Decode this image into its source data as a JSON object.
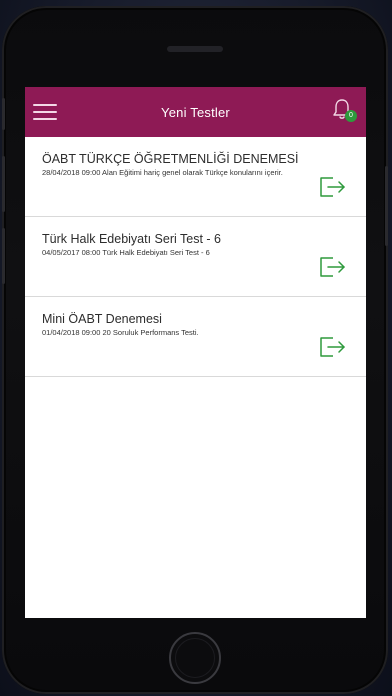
{
  "header": {
    "title": "Yeni Testler",
    "notification_count": "0",
    "menu_icon": "hamburger-icon",
    "bell_icon": "bell-icon"
  },
  "tests": [
    {
      "title": "ÖABT TÜRKÇE ÖĞRETMENLİĞİ DENEMESİ",
      "subtitle": "28/04/2018 09:00 Alan Eğitimi hariç genel olarak Türkçe konularını içerir."
    },
    {
      "title": "Türk Halk Edebiyatı Seri Test - 6",
      "subtitle": "04/05/2017 08:00 Türk Halk Edebiyatı Seri Test - 6"
    },
    {
      "title": "Mini ÖABT Denemesi",
      "subtitle": "01/04/2018 09:00 20 Soruluk Performans Testi."
    }
  ],
  "colors": {
    "appbar": "#8e1a55",
    "badge": "#2e9a3c",
    "enter_icon": "#2e9a3c"
  }
}
